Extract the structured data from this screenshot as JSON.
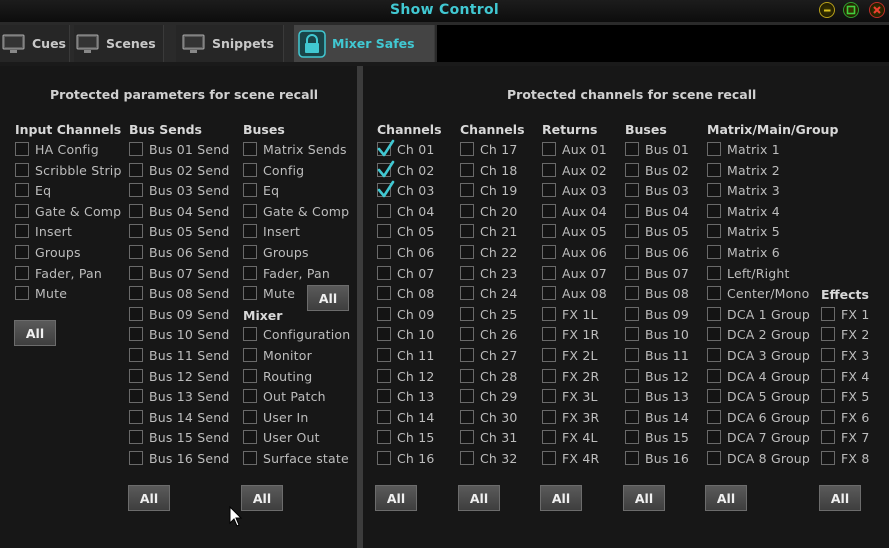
{
  "window": {
    "title": "Show Control"
  },
  "tabs": [
    {
      "label": "Cues",
      "icon": "monitor-icon"
    },
    {
      "label": "Scenes",
      "icon": "monitor-icon"
    },
    {
      "label": "Snippets",
      "icon": "monitor-icon"
    },
    {
      "label": "Mixer Safes",
      "icon": "lock-icon",
      "active": true
    }
  ],
  "left": {
    "title": "Protected parameters for scene recall",
    "input_channels": {
      "header": "Input Channels",
      "items": [
        "HA Config",
        "Scribble Strip",
        "Eq",
        "Gate & Comp",
        "Insert",
        "Groups",
        "Fader, Pan",
        "Mute"
      ]
    },
    "bus_sends": {
      "header": "Bus Sends",
      "items": [
        "Bus 01 Send",
        "Bus 02 Send",
        "Bus 03 Send",
        "Bus 04 Send",
        "Bus 05 Send",
        "Bus 06 Send",
        "Bus 07 Send",
        "Bus 08 Send",
        "Bus 09 Send",
        "Bus 10 Send",
        "Bus 11 Send",
        "Bus 12 Send",
        "Bus 13 Send",
        "Bus 14 Send",
        "Bus 15 Send",
        "Bus 16 Send"
      ]
    },
    "buses": {
      "header": "Buses",
      "items": [
        "Matrix Sends",
        "Config",
        "Eq",
        "Gate & Comp",
        "Insert",
        "Groups",
        "Fader, Pan",
        "Mute"
      ]
    },
    "mixer": {
      "header": "Mixer",
      "items": [
        "Configuration",
        "Monitor",
        "Routing",
        "Out Patch",
        "User In",
        "User Out",
        "Surface state"
      ]
    },
    "all_label": "All"
  },
  "right": {
    "title": "Protected channels for scene recall",
    "channels_a": {
      "header": "Channels",
      "items": [
        "Ch 01",
        "Ch 02",
        "Ch 03",
        "Ch 04",
        "Ch 05",
        "Ch 06",
        "Ch 07",
        "Ch 08",
        "Ch 09",
        "Ch 10",
        "Ch 11",
        "Ch 12",
        "Ch 13",
        "Ch 14",
        "Ch 15",
        "Ch 16"
      ],
      "checked": [
        true,
        true,
        true,
        false,
        false,
        false,
        false,
        false,
        false,
        false,
        false,
        false,
        false,
        false,
        false,
        false
      ]
    },
    "channels_b": {
      "header": "Channels",
      "items": [
        "Ch 17",
        "Ch 18",
        "Ch 19",
        "Ch 20",
        "Ch 21",
        "Ch 22",
        "Ch 23",
        "Ch 24",
        "Ch 25",
        "Ch 26",
        "Ch 27",
        "Ch 28",
        "Ch 29",
        "Ch 30",
        "Ch 31",
        "Ch 32"
      ]
    },
    "returns": {
      "header": "Returns",
      "items": [
        "Aux 01",
        "Aux 02",
        "Aux 03",
        "Aux 04",
        "Aux 05",
        "Aux 06",
        "Aux 07",
        "Aux 08",
        "FX 1L",
        "FX 1R",
        "FX 2L",
        "FX 2R",
        "FX 3L",
        "FX 3R",
        "FX 4L",
        "FX 4R"
      ]
    },
    "buses": {
      "header": "Buses",
      "items": [
        "Bus 01",
        "Bus 02",
        "Bus 03",
        "Bus 04",
        "Bus 05",
        "Bus 06",
        "Bus 07",
        "Bus 08",
        "Bus 09",
        "Bus 10",
        "Bus 11",
        "Bus 12",
        "Bus 13",
        "Bus 14",
        "Bus 15",
        "Bus 16"
      ]
    },
    "matrix_main_group": {
      "header": "Matrix/Main/Group",
      "items": [
        "Matrix 1",
        "Matrix 2",
        "Matrix 3",
        "Matrix 4",
        "Matrix 5",
        "Matrix 6",
        "Left/Right",
        "Center/Mono",
        "DCA 1 Group",
        "DCA 2 Group",
        "DCA 3 Group",
        "DCA 4 Group",
        "DCA 5 Group",
        "DCA 6 Group",
        "DCA 7 Group",
        "DCA 8 Group"
      ]
    },
    "effects": {
      "header": "Effects",
      "items": [
        "FX 1",
        "FX 2",
        "FX 3",
        "FX 4",
        "FX 5",
        "FX 6",
        "FX 7",
        "FX 8"
      ]
    },
    "all_label": "All"
  },
  "colors": {
    "accent": "#41c8d2",
    "background": "#171717",
    "button": "#4a4a4a"
  }
}
